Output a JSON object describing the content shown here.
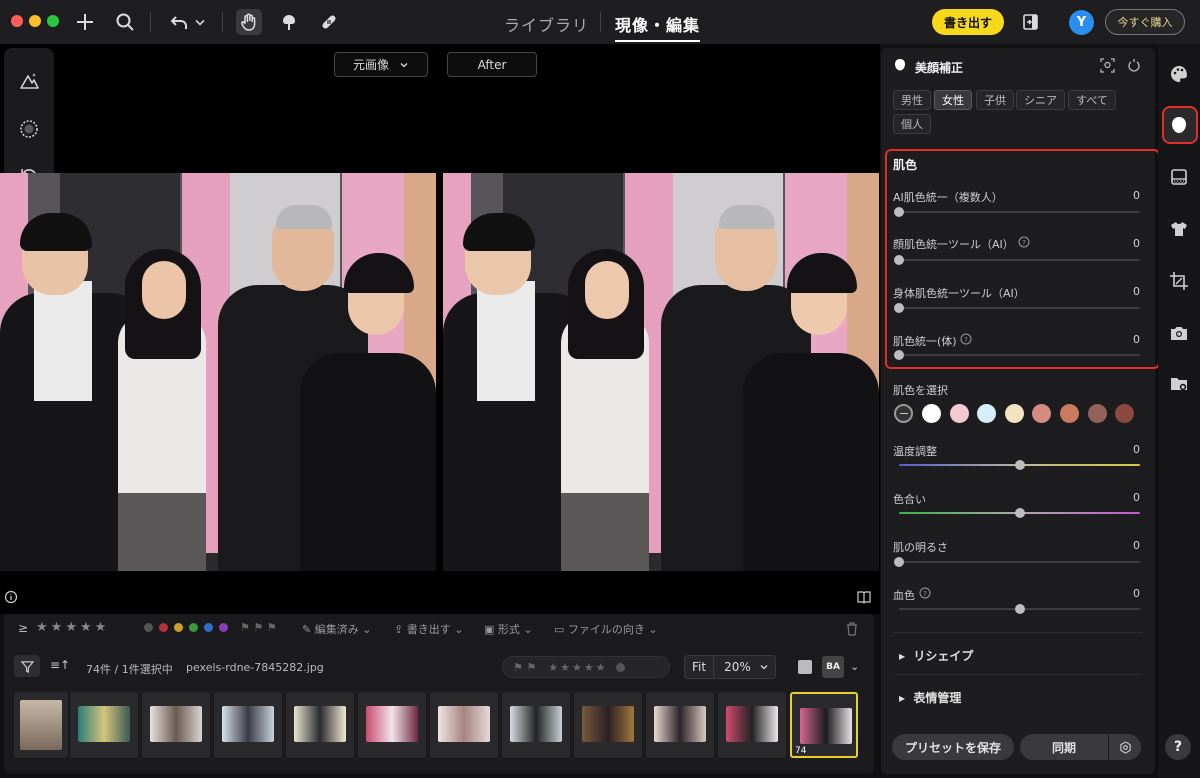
{
  "titlebar": {
    "tabs": [
      "ライブラリ",
      "現像・編集"
    ],
    "active_tab": 1,
    "export_label": "書き出す",
    "avatar_letter": "Y",
    "buy_label": "今すぐ購入"
  },
  "viewer": {
    "before_label": "元画像",
    "after_label": "After"
  },
  "filmstrip": {
    "toolbar": {
      "edited": "編集済み",
      "export": "書き出す",
      "format": "形式",
      "orientation": "ファイルの向き"
    },
    "count_text": "74件 / 1件選択中",
    "filename": "pexels-rdne-7845282.jpg",
    "fit_label": "Fit",
    "zoom_value": "20%",
    "compare_label": "BA",
    "selected_index_label": "74"
  },
  "panel": {
    "title": "美顔補正",
    "gender_chips": [
      "男性",
      "女性",
      "子供",
      "シニア",
      "すべて",
      "個人"
    ],
    "active_chip": 1,
    "skin_section_title": "肌色",
    "skin_sliders": [
      {
        "label": "AI肌色統一（複数人）",
        "value": "0"
      },
      {
        "label": "顔肌色統一ツール（AI）",
        "value": "0"
      },
      {
        "label": "身体肌色統一ツール（AI）",
        "value": "0"
      },
      {
        "label": "肌色統一(体)",
        "value": "0"
      }
    ],
    "select_skin_label": "肌色を選択",
    "skin_swatches": [
      "#ffffff",
      "#f3c9d2",
      "#d6eefa",
      "#f3e3c1",
      "#d48b80",
      "#c97a5f",
      "#93625a",
      "#8a4a3f"
    ],
    "temp_label": "温度調整",
    "temp_value": "0",
    "tint_label": "色合い",
    "tint_value": "0",
    "brightness_label": "肌の明るさ",
    "brightness_value": "0",
    "blood_label": "血色",
    "blood_value": "0",
    "reshape_label": "リシェイプ",
    "expression_label": "表情管理",
    "save_preset_label": "プリセットを保存",
    "sync_label": "同期"
  },
  "rightbar": {
    "help_label": "?"
  }
}
